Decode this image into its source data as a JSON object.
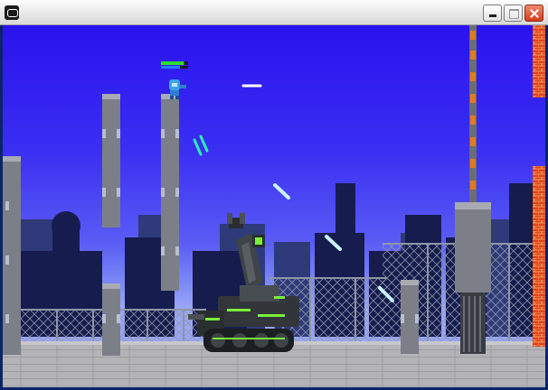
{
  "window": {
    "title": ""
  },
  "controls": {
    "minimize": "minimize",
    "maximize": "maximize",
    "close": "close"
  },
  "player": {
    "health_fraction": 0.85,
    "energy_fraction": 0.7
  },
  "colors": {
    "sky_top": "#2a12ee",
    "sky_bottom": "#8a96f7",
    "tank_accent": "#7aef3a",
    "laser": "#c8f4ff",
    "health_bar": "#2fdc2f",
    "energy_bar": "#2a7aff"
  }
}
